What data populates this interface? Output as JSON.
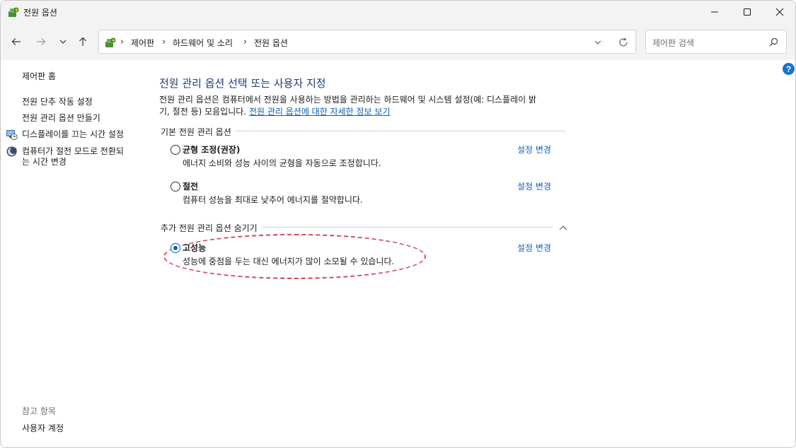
{
  "window": {
    "title": "전원 옵션"
  },
  "navigation": {
    "breadcrumbs": [
      "제어판",
      "하드웨어 및 소리",
      "전원 옵션"
    ],
    "breadcrumb_separator": "›",
    "search_placeholder": "제어판 검색"
  },
  "sidebar": {
    "home_link": "제어판 홈",
    "links": [
      {
        "label": "전원 단추 작동 설정"
      },
      {
        "label": "전원 관리 옵션 만들기"
      },
      {
        "label": "디스플레이를 끄는 시간 설정",
        "icon": "display-clock-icon"
      },
      {
        "label_line1": "컴퓨터가 절전 모드로 전환되",
        "label_line2": "는 시간 변경",
        "icon": "moon-icon"
      }
    ],
    "see_also_header": "참고 항목",
    "see_also_links": [
      {
        "label": "사용자 계정"
      }
    ]
  },
  "main": {
    "title": "전원 관리 옵션 선택 또는 사용자 지정",
    "description_line1": "전원 관리 옵션은 컴퓨터에서 전원을 사용하는 방법을 관리하는 하드웨어 및 시스템 설정(예: 디스플레이 밝",
    "description_line2": "기, 절전 등) 모음입니다.",
    "description_link": "전원 관리 옵션에 대한 자세한 정보 보기",
    "default_plans_header": "기본 전원 관리 옵션",
    "additional_plans_header": "추가 전원 관리 옵션 숨기기",
    "plans": [
      {
        "name": "균형 조정(권장)",
        "description": "에너지 소비와 성능 사이의 균형을 자동으로 조정합니다.",
        "link": "설정 변경",
        "selected": false
      },
      {
        "name": "절전",
        "description": "컴퓨터 성능을 최대로 낮추어 에너지를 절약합니다.",
        "link": "설정 변경",
        "selected": false
      },
      {
        "name": "고성능",
        "description": "성능에 중점을 두는 대신 에너지가 많이 소모될 수 있습니다.",
        "link": "설정 변경",
        "selected": true
      }
    ]
  },
  "colors": {
    "accent": "#0b5fb4",
    "title": "#1e3c78",
    "highlight_annotation": "#d14a5a"
  }
}
